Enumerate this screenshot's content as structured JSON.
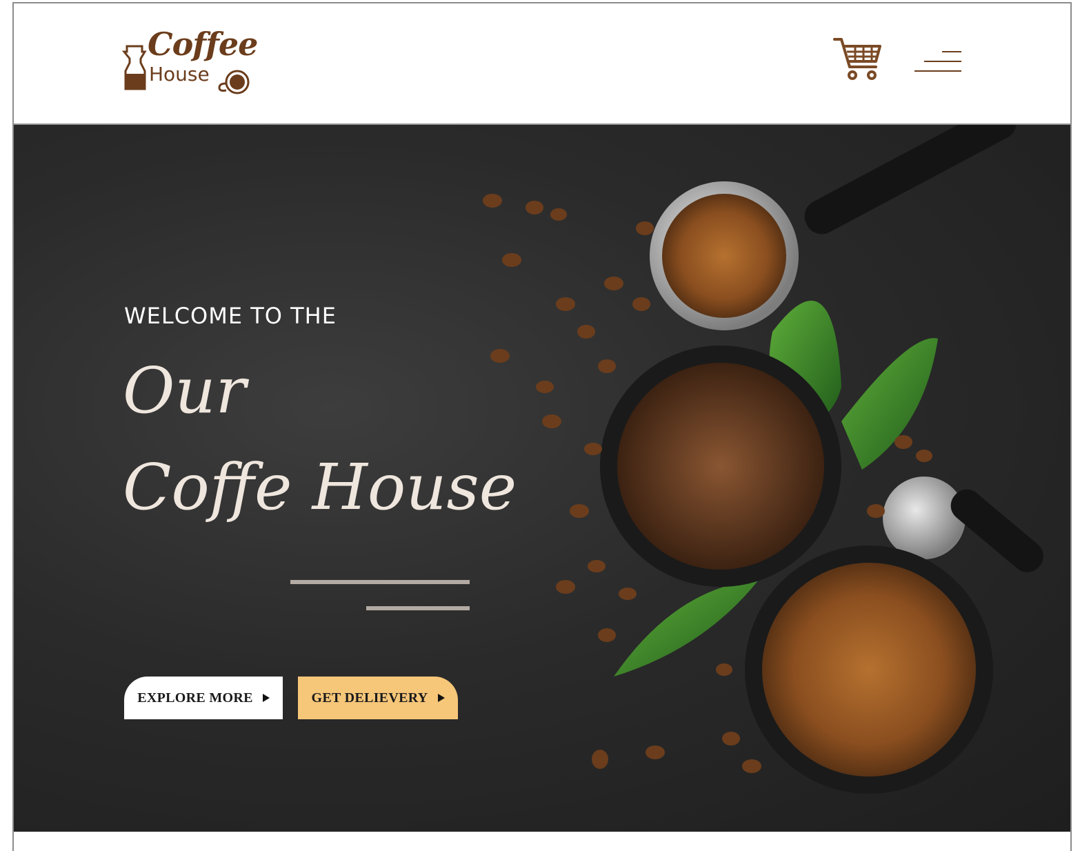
{
  "header": {
    "logo": {
      "word1": "Coffee",
      "word2": "House"
    },
    "cart_icon": "cart-icon",
    "menu_icon": "hamburger-menu-icon"
  },
  "hero": {
    "welcome": "WELCOME TO THE",
    "title_line1": "Our",
    "title_line2": "Coffe House",
    "buttons": {
      "explore_label": "EXPLORE MORE",
      "delivery_label": "GET DELIEVERY"
    },
    "background_image": "coffee beans, ground coffee bowls, portafilters and green coffee leaves on dark slate"
  },
  "colors": {
    "brand_brown": "#6b3d1c",
    "delivery_button": "#f6c679",
    "hero_bg": "#2a2a2a",
    "title_text": "#efe6de"
  }
}
